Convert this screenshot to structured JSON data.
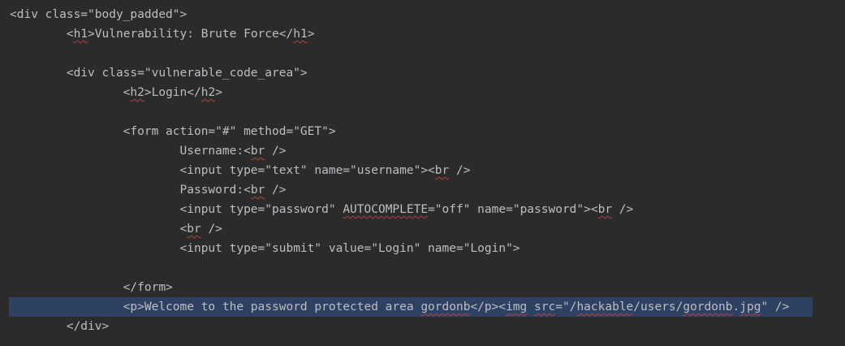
{
  "code_lines": [
    {
      "segments": [
        {
          "text": "<div class=\"body_padded\">"
        }
      ]
    },
    {
      "segments": [
        {
          "text": "        <"
        },
        {
          "text": "h1",
          "typo": true
        },
        {
          "text": ">Vulnerability: Brute Force</"
        },
        {
          "text": "h1",
          "typo": true
        },
        {
          "text": ">"
        }
      ]
    },
    {
      "segments": []
    },
    {
      "segments": [
        {
          "text": "        <div class=\"vulnerable_code_area\">"
        }
      ]
    },
    {
      "segments": [
        {
          "text": "                <"
        },
        {
          "text": "h2",
          "typo": true
        },
        {
          "text": ">Login</"
        },
        {
          "text": "h2",
          "typo": true
        },
        {
          "text": ">"
        }
      ]
    },
    {
      "segments": []
    },
    {
      "segments": [
        {
          "text": "                <form action=\"#\" method=\"GET\">"
        }
      ]
    },
    {
      "segments": [
        {
          "text": "                        Username:<"
        },
        {
          "text": "br",
          "typo": true
        },
        {
          "text": " />"
        }
      ]
    },
    {
      "segments": [
        {
          "text": "                        <input type=\"text\" name=\"username\"><"
        },
        {
          "text": "br",
          "typo": true
        },
        {
          "text": " />"
        }
      ]
    },
    {
      "segments": [
        {
          "text": "                        Password:<"
        },
        {
          "text": "br",
          "typo": true
        },
        {
          "text": " />"
        }
      ]
    },
    {
      "segments": [
        {
          "text": "                        <input type=\"password\" "
        },
        {
          "text": "AUTOCOMPLETE",
          "typo": true
        },
        {
          "text": "=\"off\" name=\"password\"><"
        },
        {
          "text": "br",
          "typo": true
        },
        {
          "text": " />"
        }
      ]
    },
    {
      "segments": [
        {
          "text": "                        <"
        },
        {
          "text": "br",
          "typo": true
        },
        {
          "text": " />"
        }
      ]
    },
    {
      "segments": [
        {
          "text": "                        <input type=\"submit\" value=\"Login\" name=\"Login\">"
        }
      ]
    },
    {
      "segments": []
    },
    {
      "segments": [
        {
          "text": "                </form>"
        }
      ]
    },
    {
      "selected": true,
      "segments": [
        {
          "text": "                <p>Welcome to the password protected area "
        },
        {
          "text": "gordonb",
          "typo": true
        },
        {
          "text": "</p><"
        },
        {
          "text": "img",
          "typo": true
        },
        {
          "text": " "
        },
        {
          "text": "src",
          "typo": true
        },
        {
          "text": "=\"/"
        },
        {
          "text": "hackable",
          "typo": true
        },
        {
          "text": "/users/"
        },
        {
          "text": "gordonb",
          "typo": true
        },
        {
          "text": "."
        },
        {
          "text": "jpg",
          "typo": true
        },
        {
          "text": "\" />"
        }
      ]
    },
    {
      "segments": [
        {
          "text": "        </div>"
        }
      ]
    }
  ],
  "colors": {
    "background": "#2b2b2b",
    "text": "#bcbec4",
    "selection": "#2f4162",
    "typo_underline": "#b04040"
  }
}
